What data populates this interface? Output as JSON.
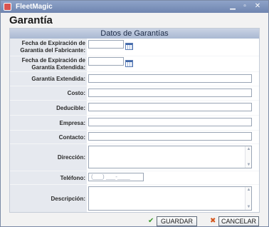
{
  "window": {
    "title": "FleetMagic"
  },
  "page": {
    "title": "Garantía"
  },
  "section": {
    "header": "Datos de Garantías"
  },
  "fields": {
    "fecha_exp_fabricante": {
      "label_line1": "Fecha de Expiración de",
      "label_line2": "Garantía del Fabricante:",
      "value": ""
    },
    "fecha_exp_extendida": {
      "label_line1": "Fecha de Expiración de",
      "label_line2": "Garantía Extendida:",
      "value": ""
    },
    "garantia_extendida": {
      "label": "Garantía Extendida:",
      "value": ""
    },
    "costo": {
      "label": "Costo:",
      "value": ""
    },
    "deducible": {
      "label": "Deducible:",
      "value": ""
    },
    "empresa": {
      "label": "Empresa:",
      "value": ""
    },
    "contacto": {
      "label": "Contacto:",
      "value": ""
    },
    "direccion": {
      "label": "Dirección:",
      "value": ""
    },
    "telefono": {
      "label": "Teléfono:",
      "mask": "(___) ___-____"
    },
    "descripcion": {
      "label": "Descripción:",
      "value": ""
    }
  },
  "buttons": {
    "save": "GUARDAR",
    "cancel": "CANCELAR"
  },
  "icons": {
    "window": "app-icon",
    "calendar": "calendar-icon",
    "save": "check-icon",
    "cancel": "x-icon"
  },
  "colors": {
    "titlebar": "#7b90ba",
    "check": "#3a9a2a",
    "cancel_x": "#d4561c"
  }
}
